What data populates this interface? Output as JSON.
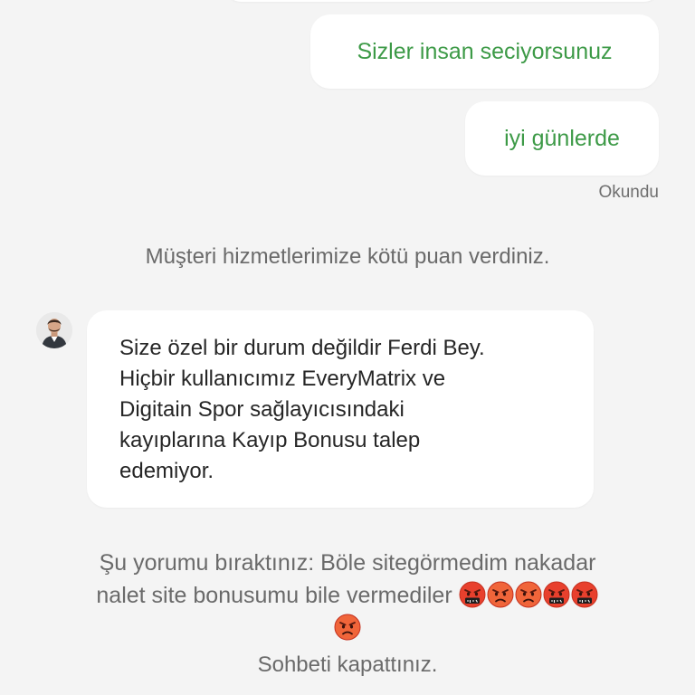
{
  "messages": {
    "user_1": "Sizler insan seciyorsunuz",
    "user_2": "iyi günlerde",
    "read_status": "Okundu"
  },
  "system": {
    "rating_notice": "Müşteri hizmetlerimize kötü puan verdiniz.",
    "comment_line_1": "Şu yorumu bıraktınız: Böle sitegörmedim nakadar",
    "comment_line_2": "nalet site bonusumu bile vermediler",
    "comment_emojis": [
      "cursing-face",
      "angry-face",
      "angry-face",
      "cursing-face",
      "cursing-face",
      "angry-face"
    ],
    "chat_closed": "Sohbeti kapattınız."
  },
  "agent": {
    "avatar": "agent-avatar",
    "message_lines": [
      "Size özel bir durum değildir Ferdi Bey.",
      "Hiçbir kullanıcımız EveryMatrix ve",
      "Digitain Spor sağlayıcısındaki",
      "kayıplarına Kayıp Bonusu talep",
      "edemiyor."
    ]
  },
  "colors": {
    "background": "#f4f4f4",
    "user_text": "#3d9a47",
    "system_text": "#6a6a6a",
    "bubble": "#ffffff",
    "emoji_red": "#e8402d",
    "emoji_orange": "#f0653a"
  }
}
